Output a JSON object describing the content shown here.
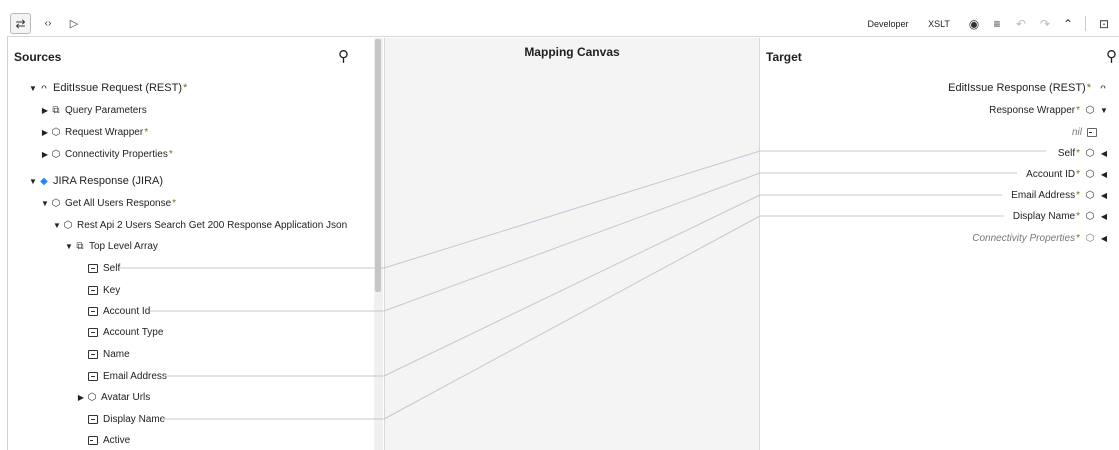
{
  "toolbar": {
    "left_icons": [
      "swap-icon",
      "code-icon",
      "play-icon"
    ],
    "developer_label": "Developer",
    "xslt_label": "XSLT"
  },
  "sources": {
    "title": "Sources",
    "root1": "EditIssue Request (REST)",
    "query_params": "Query Parameters",
    "request_wrapper": "Request Wrapper",
    "connectivity": "Connectivity Properties",
    "root2": "JIRA Response (JIRA)",
    "get_all_users": "Get All Users Response",
    "rest_api": "Rest Api 2 Users Search Get 200 Response Application Json",
    "top_level_array": "Top Level Array",
    "fields": [
      "Self",
      "Key",
      "Account Id",
      "Account Type",
      "Name",
      "Email Address",
      "Avatar Urls",
      "Display Name",
      "Active"
    ]
  },
  "canvas": {
    "title": "Mapping Canvas"
  },
  "target": {
    "title": "Target",
    "root": "EditIssue Response (REST)",
    "response_wrapper": "Response Wrapper",
    "nil": "nil",
    "fields": [
      "Self",
      "Account ID",
      "Email Address",
      "Display Name"
    ],
    "connectivity": "Connectivity Properties"
  },
  "required_mark": "*",
  "colors": {
    "link": "#c5c8d6",
    "required": "#5f7a1c",
    "canvas_bg": "#f4f4f4",
    "jira": "#2684ff"
  }
}
